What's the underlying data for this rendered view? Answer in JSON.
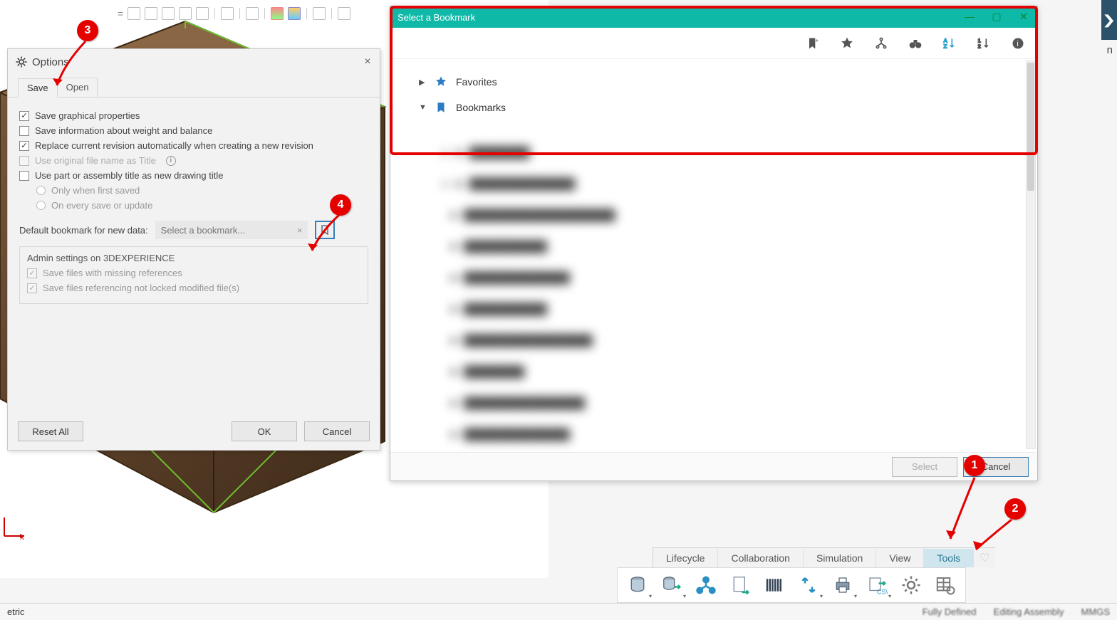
{
  "options_dialog": {
    "title": "Options",
    "close_icon": "×",
    "tabs": {
      "save": "Save",
      "open": "Open"
    },
    "checks": {
      "graphical": "Save graphical properties",
      "weight": "Save information about weight and balance",
      "replace_rev": "Replace current revision automatically when creating a new revision",
      "use_orig_title": "Use original file name as Title",
      "use_part_title": "Use part or assembly title as new drawing title",
      "only_first": "Only when first saved",
      "every_save": "On every save or update"
    },
    "bookmark_label": "Default bookmark for new data:",
    "bookmark_placeholder": "Select a bookmark...",
    "admin": {
      "legend": "Admin settings on 3DEXPERIENCE",
      "missing_refs": "Save files with missing references",
      "locked_mod": "Save files referencing not locked modified file(s)"
    },
    "buttons": {
      "reset": "Reset All",
      "ok": "OK",
      "cancel": "Cancel"
    }
  },
  "bookmark_window": {
    "title": "Select a Bookmark",
    "toolbar_icons": [
      "bookmark-add-icon",
      "star-icon",
      "tree-icon",
      "binoculars-icon",
      "sort-az-icon",
      "sort-za-icon",
      "info-icon"
    ],
    "tree": {
      "favorites": "Favorites",
      "bookmarks": "Bookmarks"
    },
    "footer": {
      "select": "Select",
      "cancel": "Cancel"
    }
  },
  "ribbon": {
    "tabs": [
      "Lifecycle",
      "Collaboration",
      "Simulation",
      "View",
      "Tools"
    ],
    "active_tab": "Tools",
    "tool_names": [
      "database-icon",
      "export-db-icon",
      "relations-icon",
      "open-doc-icon",
      "barcode-icon",
      "update-icon",
      "print-icon",
      "export-csv-icon",
      "options-gear-icon",
      "table-settings-icon"
    ]
  },
  "status": {
    "view": "etric",
    "right1": "Fully Defined",
    "right2": "Editing Assembly",
    "right3": "MMGS"
  },
  "callouts": {
    "b1": "1",
    "b2": "2",
    "b3": "3",
    "b4": "4"
  },
  "axis_label": "x"
}
